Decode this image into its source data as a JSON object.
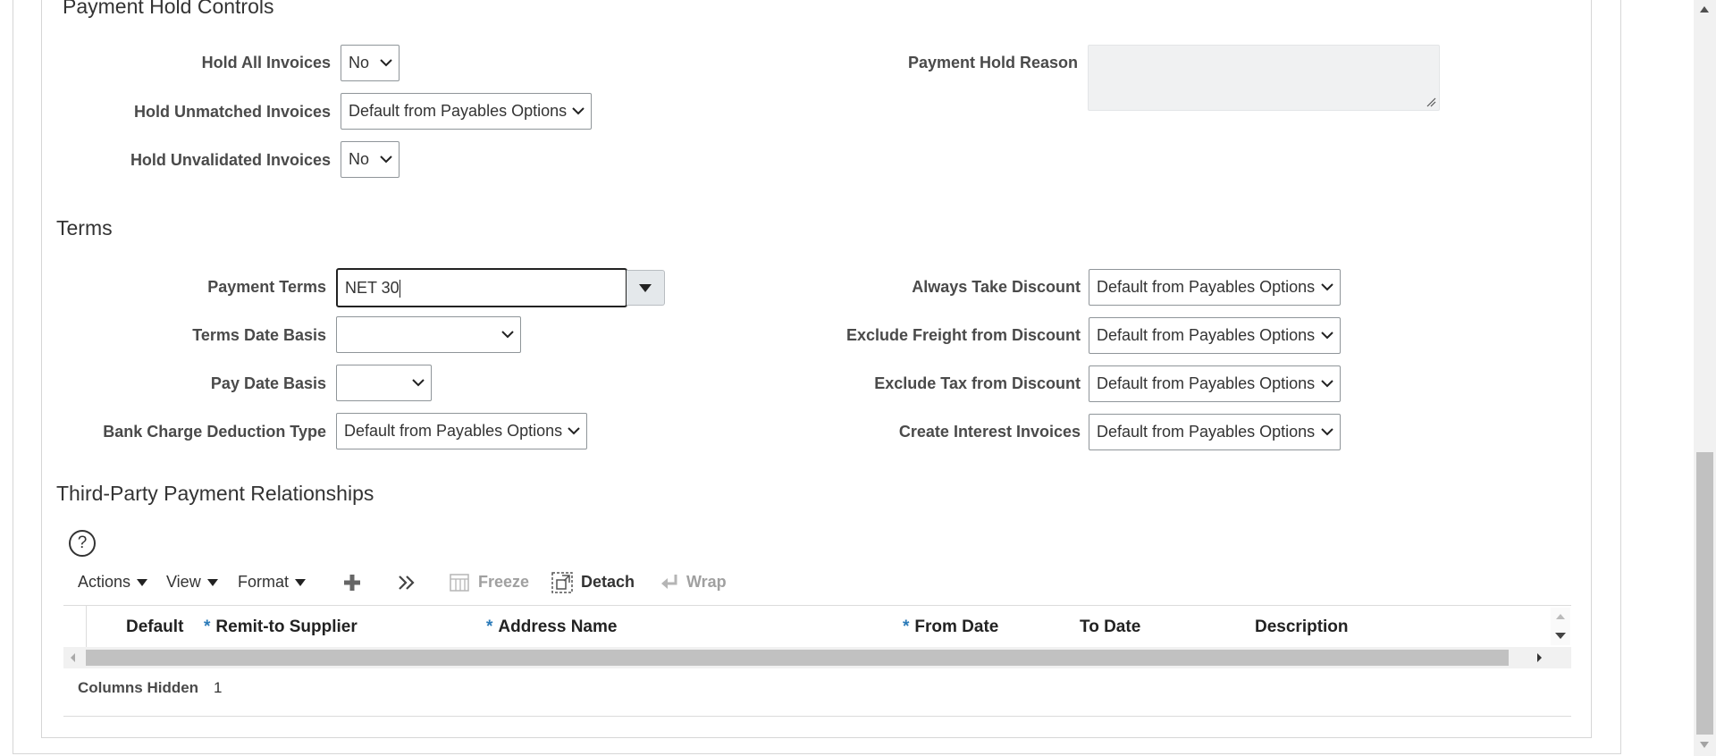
{
  "payment_hold": {
    "title": "Payment Hold Controls",
    "hold_all_label": "Hold All Invoices",
    "hold_all_value": "No",
    "hold_unmatched_label": "Hold Unmatched Invoices",
    "hold_unmatched_value": "Default from Payables Options",
    "hold_unvalidated_label": "Hold Unvalidated Invoices",
    "hold_unvalidated_value": "No",
    "reason_label": "Payment Hold Reason",
    "reason_value": ""
  },
  "terms": {
    "title": "Terms",
    "payment_terms_label": "Payment Terms",
    "payment_terms_value": "NET 30",
    "terms_date_basis_label": "Terms Date Basis",
    "terms_date_basis_value": "",
    "pay_date_basis_label": "Pay Date Basis",
    "pay_date_basis_value": "",
    "bank_charge_label": "Bank Charge Deduction Type",
    "bank_charge_value": "Default from Payables Options",
    "always_take_discount_label": "Always Take Discount",
    "always_take_discount_value": "Default from Payables Options",
    "exclude_freight_label": "Exclude Freight from Discount",
    "exclude_freight_value": "Default from Payables Options",
    "exclude_tax_label": "Exclude Tax from Discount",
    "exclude_tax_value": "Default from Payables Options",
    "create_interest_label": "Create Interest Invoices",
    "create_interest_value": "Default from Payables Options"
  },
  "third_party": {
    "title": "Third-Party Payment Relationships",
    "help_glyph": "?",
    "toolbar": {
      "actions": "Actions",
      "view": "View",
      "format": "Format",
      "freeze": "Freeze",
      "detach": "Detach",
      "wrap": "Wrap"
    },
    "columns": {
      "default": "Default",
      "remit_to_supplier": "Remit-to Supplier",
      "address_name": "Address Name",
      "from_date": "From Date",
      "to_date": "To Date",
      "description": "Description"
    },
    "required_marker": "*",
    "columns_hidden_label": "Columns Hidden",
    "columns_hidden_count": "1"
  },
  "colors": {
    "required": "#2a7ab8",
    "label": "#4a4a4a",
    "textarea_bg": "#f0f1f2"
  }
}
